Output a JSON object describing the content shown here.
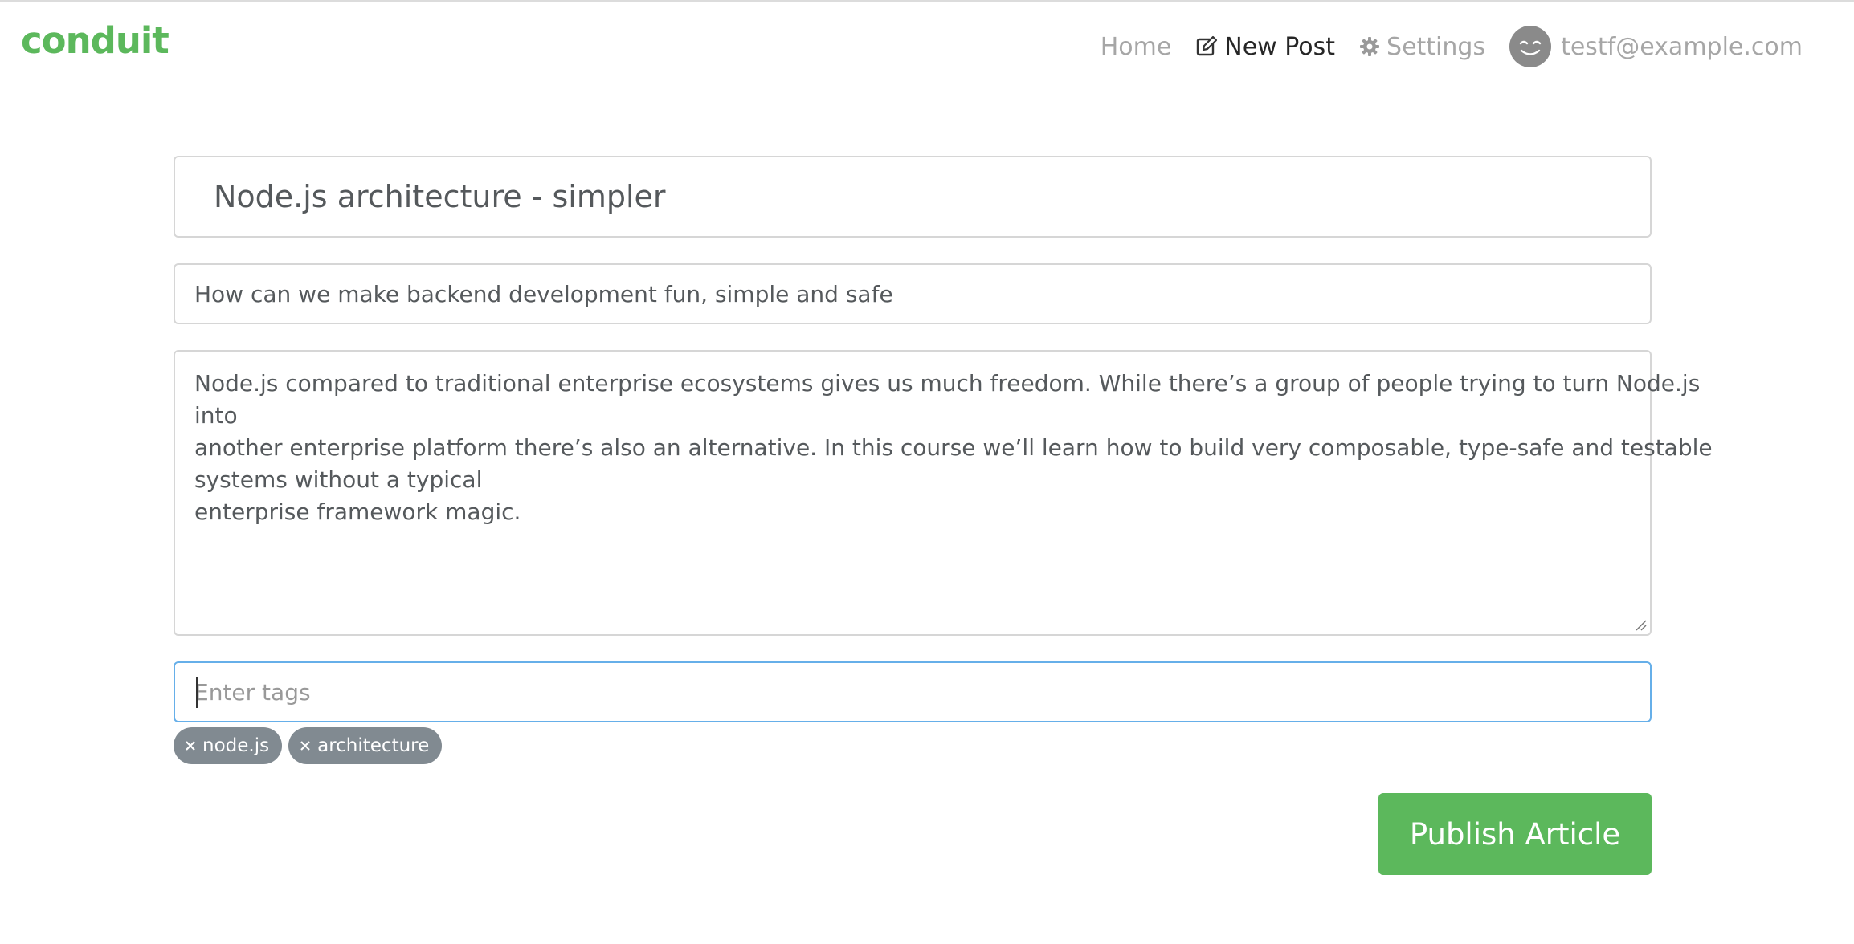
{
  "brand": "conduit",
  "nav": {
    "home": "Home",
    "new_post": "New Post",
    "settings": "Settings",
    "user": "testf@example.com"
  },
  "editor": {
    "title_value": "Node.js architecture - simpler",
    "about_value": "How can we make backend development fun, simple and safe",
    "body_lines": [
      "Node.js compared to traditional enterprise ecosystems gives us much freedom. While there’s a group of people trying to turn Node.js",
      "into",
      "another enterprise platform there’s also an alternative. In this course we’ll learn how to build very composable, type-safe and testable",
      "systems without a typical",
      "enterprise framework magic."
    ],
    "tags_placeholder": "Enter tags",
    "tags": [
      "node.js",
      "architecture"
    ],
    "publish_label": "Publish Article"
  },
  "colors": {
    "brand": "#5cb85c",
    "tag_bg": "#818a91",
    "focus_border": "#66afe9"
  },
  "icons": {
    "new_post": "edit-icon",
    "settings": "gear-icon",
    "avatar": "smiley-avatar",
    "tag_remove": "close-icon"
  }
}
